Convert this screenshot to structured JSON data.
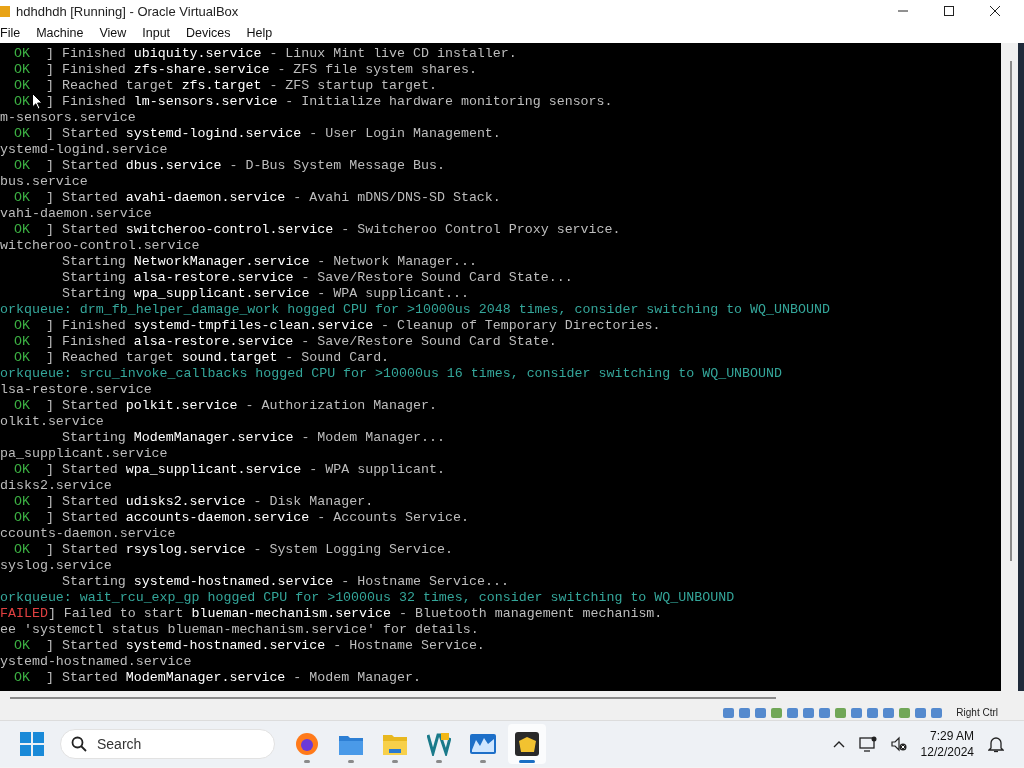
{
  "window": {
    "title": "hdhdhdh [Running] - Oracle VirtualBox"
  },
  "menu": [
    "File",
    "Machine",
    "View",
    "Input",
    "Devices",
    "Help"
  ],
  "console": [
    {
      "kind": "ok",
      "status": "OK",
      "bracket": "]",
      "verb": "Finished",
      "unit": "ubiquity.service",
      "desc": "- Linux Mint live CD installer."
    },
    {
      "kind": "ok",
      "status": "OK",
      "bracket": "]",
      "verb": "Finished",
      "unit": "zfs-share.service",
      "desc": "- ZFS file system shares."
    },
    {
      "kind": "ok",
      "status": "OK",
      "bracket": "]",
      "verb": "Reached target",
      "unit": "zfs.target",
      "desc": "- ZFS startup target."
    },
    {
      "kind": "ok",
      "status": "OK",
      "bracket": "]",
      "verb": "Finished",
      "unit": "lm-sensors.service",
      "desc": "- Initialize hardware monitoring sensors."
    },
    {
      "kind": "plain",
      "text": "m-sensors.service"
    },
    {
      "kind": "ok",
      "status": "OK",
      "bracket": "]",
      "verb": "Started",
      "unit": "systemd-logind.service",
      "desc": "- User Login Management."
    },
    {
      "kind": "plain",
      "text": "ystemd-logind.service"
    },
    {
      "kind": "ok",
      "status": "OK",
      "bracket": "]",
      "verb": "Started",
      "unit": "dbus.service",
      "desc": "- D-Bus System Message Bus."
    },
    {
      "kind": "plain",
      "text": "bus.service"
    },
    {
      "kind": "ok",
      "status": "OK",
      "bracket": "]",
      "verb": "Started",
      "unit": "avahi-daemon.service",
      "desc": "- Avahi mDNS/DNS-SD Stack."
    },
    {
      "kind": "plain",
      "text": "vahi-daemon.service"
    },
    {
      "kind": "ok",
      "status": "OK",
      "bracket": "]",
      "verb": "Started",
      "unit": "switcheroo-control.service",
      "desc": "- Switcheroo Control Proxy service."
    },
    {
      "kind": "plain",
      "text": "witcheroo-control.service"
    },
    {
      "kind": "job",
      "verb": "Starting",
      "unit": "NetworkManager.service",
      "desc": "- Network Manager..."
    },
    {
      "kind": "job",
      "verb": "Starting",
      "unit": "alsa-restore.service",
      "desc": "- Save/Restore Sound Card State..."
    },
    {
      "kind": "job",
      "verb": "Starting",
      "unit": "wpa_supplicant.service",
      "desc": "- WPA supplicant..."
    },
    {
      "kind": "warning",
      "text": "orkqueue: drm_fb_helper_damage_work hogged CPU for >10000us 2048 times, consider switching to WQ_UNBOUND"
    },
    {
      "kind": "ok",
      "status": "OK",
      "bracket": "]",
      "verb": "Finished",
      "unit": "systemd-tmpfiles-clean.service",
      "desc": "- Cleanup of Temporary Directories."
    },
    {
      "kind": "ok",
      "status": "OK",
      "bracket": "]",
      "verb": "Finished",
      "unit": "alsa-restore.service",
      "desc": "- Save/Restore Sound Card State."
    },
    {
      "kind": "ok",
      "status": "OK",
      "bracket": "]",
      "verb": "Reached target",
      "unit": "sound.target",
      "desc": "- Sound Card."
    },
    {
      "kind": "warning",
      "text": "orkqueue: srcu_invoke_callbacks hogged CPU for >10000us 16 times, consider switching to WQ_UNBOUND"
    },
    {
      "kind": "plain",
      "text": "lsa-restore.service"
    },
    {
      "kind": "ok",
      "status": "OK",
      "bracket": "]",
      "verb": "Started",
      "unit": "polkit.service",
      "desc": "- Authorization Manager."
    },
    {
      "kind": "plain",
      "text": "olkit.service"
    },
    {
      "kind": "job",
      "verb": "Starting",
      "unit": "ModemManager.service",
      "desc": "- Modem Manager..."
    },
    {
      "kind": "plain",
      "text": "pa_supplicant.service"
    },
    {
      "kind": "ok",
      "status": "OK",
      "bracket": "]",
      "verb": "Started",
      "unit": "wpa_supplicant.service",
      "desc": "- WPA supplicant."
    },
    {
      "kind": "plain",
      "text": "disks2.service"
    },
    {
      "kind": "ok",
      "status": "OK",
      "bracket": "]",
      "verb": "Started",
      "unit": "udisks2.service",
      "desc": "- Disk Manager."
    },
    {
      "kind": "ok",
      "status": "OK",
      "bracket": "]",
      "verb": "Started",
      "unit": "accounts-daemon.service",
      "desc": "- Accounts Service."
    },
    {
      "kind": "plain",
      "text": "ccounts-daemon.service"
    },
    {
      "kind": "ok",
      "status": "OK",
      "bracket": "]",
      "verb": "Started",
      "unit": "rsyslog.service",
      "desc": "- System Logging Service."
    },
    {
      "kind": "plain",
      "text": "syslog.service"
    },
    {
      "kind": "job",
      "verb": "Starting",
      "unit": "systemd-hostnamed.service",
      "desc": "- Hostname Service..."
    },
    {
      "kind": "warning",
      "text": "orkqueue: wait_rcu_exp_gp hogged CPU for >10000us 32 times, consider switching to WQ_UNBOUND"
    },
    {
      "kind": "failed",
      "status": "FAILED",
      "bracket": "]",
      "verb": "Failed to start",
      "unit": "blueman-mechanism.service",
      "desc": "- Bluetooth management mechanism."
    },
    {
      "kind": "plain",
      "text": "ee 'systemctl status blueman-mechanism.service' for details."
    },
    {
      "kind": "ok",
      "status": "OK",
      "bracket": "]",
      "verb": "Started",
      "unit": "systemd-hostnamed.service",
      "desc": "- Hostname Service."
    },
    {
      "kind": "plain",
      "text": "ystemd-hostnamed.service"
    },
    {
      "kind": "ok",
      "status": "OK",
      "bracket": "]",
      "verb": "Started",
      "unit": "ModemManager.service",
      "desc": "- Modem Manager."
    }
  ],
  "status_bar": {
    "host_key": "Right Ctrl"
  },
  "taskbar": {
    "search": {
      "placeholder": "Search"
    },
    "apps": [
      {
        "kind": "browser",
        "selected": false
      },
      {
        "kind": "folder",
        "selected": false
      },
      {
        "kind": "explorer",
        "selected": false
      },
      {
        "kind": "code",
        "selected": false
      },
      {
        "kind": "monitor",
        "selected": false
      },
      {
        "kind": "virtualbox",
        "selected": true
      }
    ],
    "time": "7:29 AM",
    "date": "12/2/2024"
  }
}
